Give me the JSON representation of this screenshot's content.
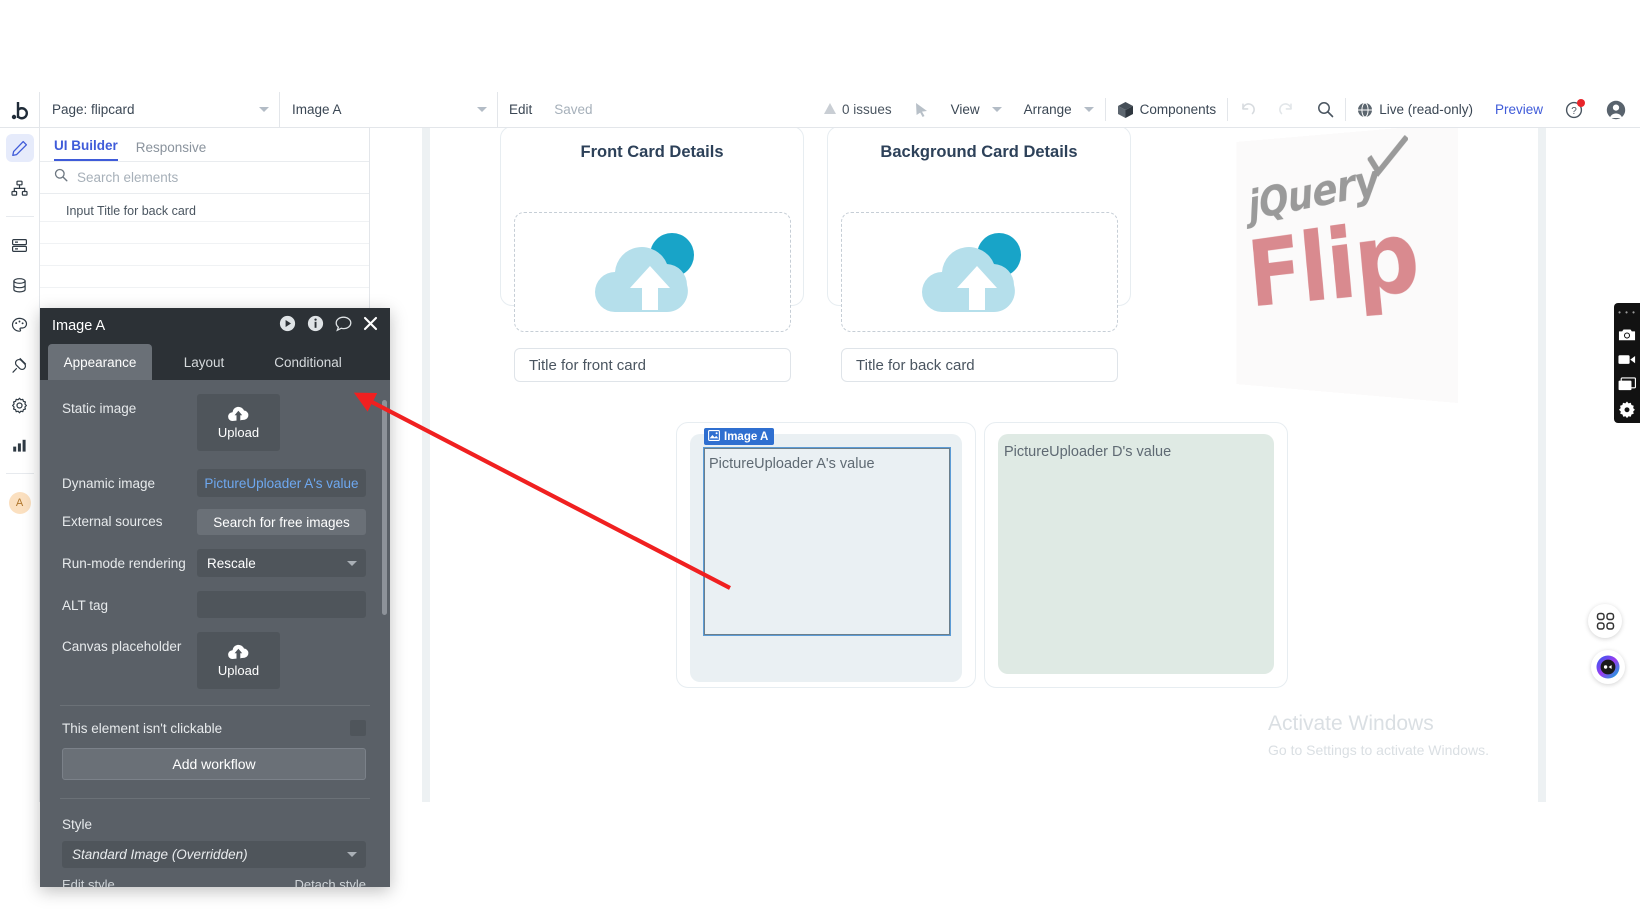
{
  "toolbar": {
    "logo": "b",
    "page_selector_label": "Page: flipcard",
    "element_selector_label": "Image A",
    "edit_label": "Edit",
    "saved_label": "Saved",
    "issues_label": "0 issues",
    "view_label": "View",
    "arrange_label": "Arrange",
    "components_label": "Components",
    "live_label": "Live (read-only)",
    "preview_label": "Preview",
    "icons": {
      "cursor": "cursor-icon",
      "undo": "undo-icon",
      "redo": "redo-icon",
      "search": "search-icon",
      "globe": "globe-icon",
      "help": "help-icon",
      "account": "account-avatar-icon"
    }
  },
  "rail": {
    "items": [
      {
        "name": "design",
        "icon": "pencil-icon",
        "active": true
      },
      {
        "name": "workflow",
        "icon": "sitemap-icon",
        "active": false
      },
      {
        "name": "data",
        "icon": "server-icon",
        "active": false
      },
      {
        "name": "database",
        "icon": "database-icon",
        "active": false
      },
      {
        "name": "styles",
        "icon": "palette-icon",
        "active": false
      },
      {
        "name": "plugins",
        "icon": "plug-icon",
        "active": false
      },
      {
        "name": "settings",
        "icon": "gear-icon",
        "active": false
      },
      {
        "name": "logs",
        "icon": "bar-chart-icon",
        "active": false
      }
    ],
    "avatar_initial": "A"
  },
  "left_panel": {
    "tabs": [
      {
        "label": "UI Builder",
        "active": true
      },
      {
        "label": "Responsive",
        "active": false
      }
    ],
    "search_placeholder": "Search elements",
    "tree_items": [
      {
        "label": "Input Title for back card"
      }
    ]
  },
  "properties": {
    "title": "Image A",
    "header_icons": [
      "play-icon",
      "info-icon",
      "comment-icon",
      "close-icon"
    ],
    "tabs": [
      {
        "label": "Appearance",
        "active": true
      },
      {
        "label": "Layout",
        "active": false
      },
      {
        "label": "Conditional",
        "active": false
      }
    ],
    "rows": [
      {
        "label": "Static image",
        "control": "upload",
        "value": "Upload"
      },
      {
        "label": "Dynamic image",
        "control": "dynamic",
        "value": "PictureUploader A's value"
      },
      {
        "label": "External sources",
        "control": "button",
        "value": "Search for free images"
      },
      {
        "label": "Run-mode rendering",
        "control": "select",
        "value": "Rescale"
      },
      {
        "label": "ALT tag",
        "control": "text",
        "value": ""
      },
      {
        "label": "Canvas placeholder",
        "control": "upload",
        "value": "Upload"
      }
    ],
    "clickable_label": "This element isn't clickable",
    "clickable_checked": false,
    "add_workflow_label": "Add workflow",
    "style_label": "Style",
    "style_value": "Standard Image (Overridden)",
    "edit_style_label": "Edit style",
    "detach_style_label": "Detach style"
  },
  "canvas": {
    "front_card": {
      "title": "Front Card Details",
      "uploader_icon": "cloud-upload-icon",
      "title_field_value": "Title for front card"
    },
    "back_card": {
      "title": "Background Card Details",
      "uploader_icon": "cloud-upload-icon",
      "title_field_value": "Title for back card"
    },
    "logo_panel": {
      "word_top": "jQuery",
      "word_bottom": "Flip"
    },
    "image_a": {
      "badge_label": "Image A",
      "badge_icon": "image-icon",
      "placeholder_text": "PictureUploader A's value"
    },
    "image_d": {
      "placeholder_text": "PictureUploader D's value"
    }
  },
  "right_widgets": {
    "recorder_icons": [
      "camera-icon",
      "video-icon",
      "window-icon",
      "gear-icon"
    ],
    "grid_icon": "grid-apps-icon",
    "assistant_icon": "ninja-assistant-icon"
  },
  "watermark": {
    "title": "Activate Windows",
    "subtitle": "Go to Settings to activate Windows."
  },
  "colors": {
    "accent_blue": "#3f5bd9",
    "panel_dark": "#5a6067",
    "panel_header": "#2c3136",
    "dynamic_link": "#6ea8f0",
    "selection_blue": "#2f6fd0",
    "annotation_red": "#f02020"
  }
}
